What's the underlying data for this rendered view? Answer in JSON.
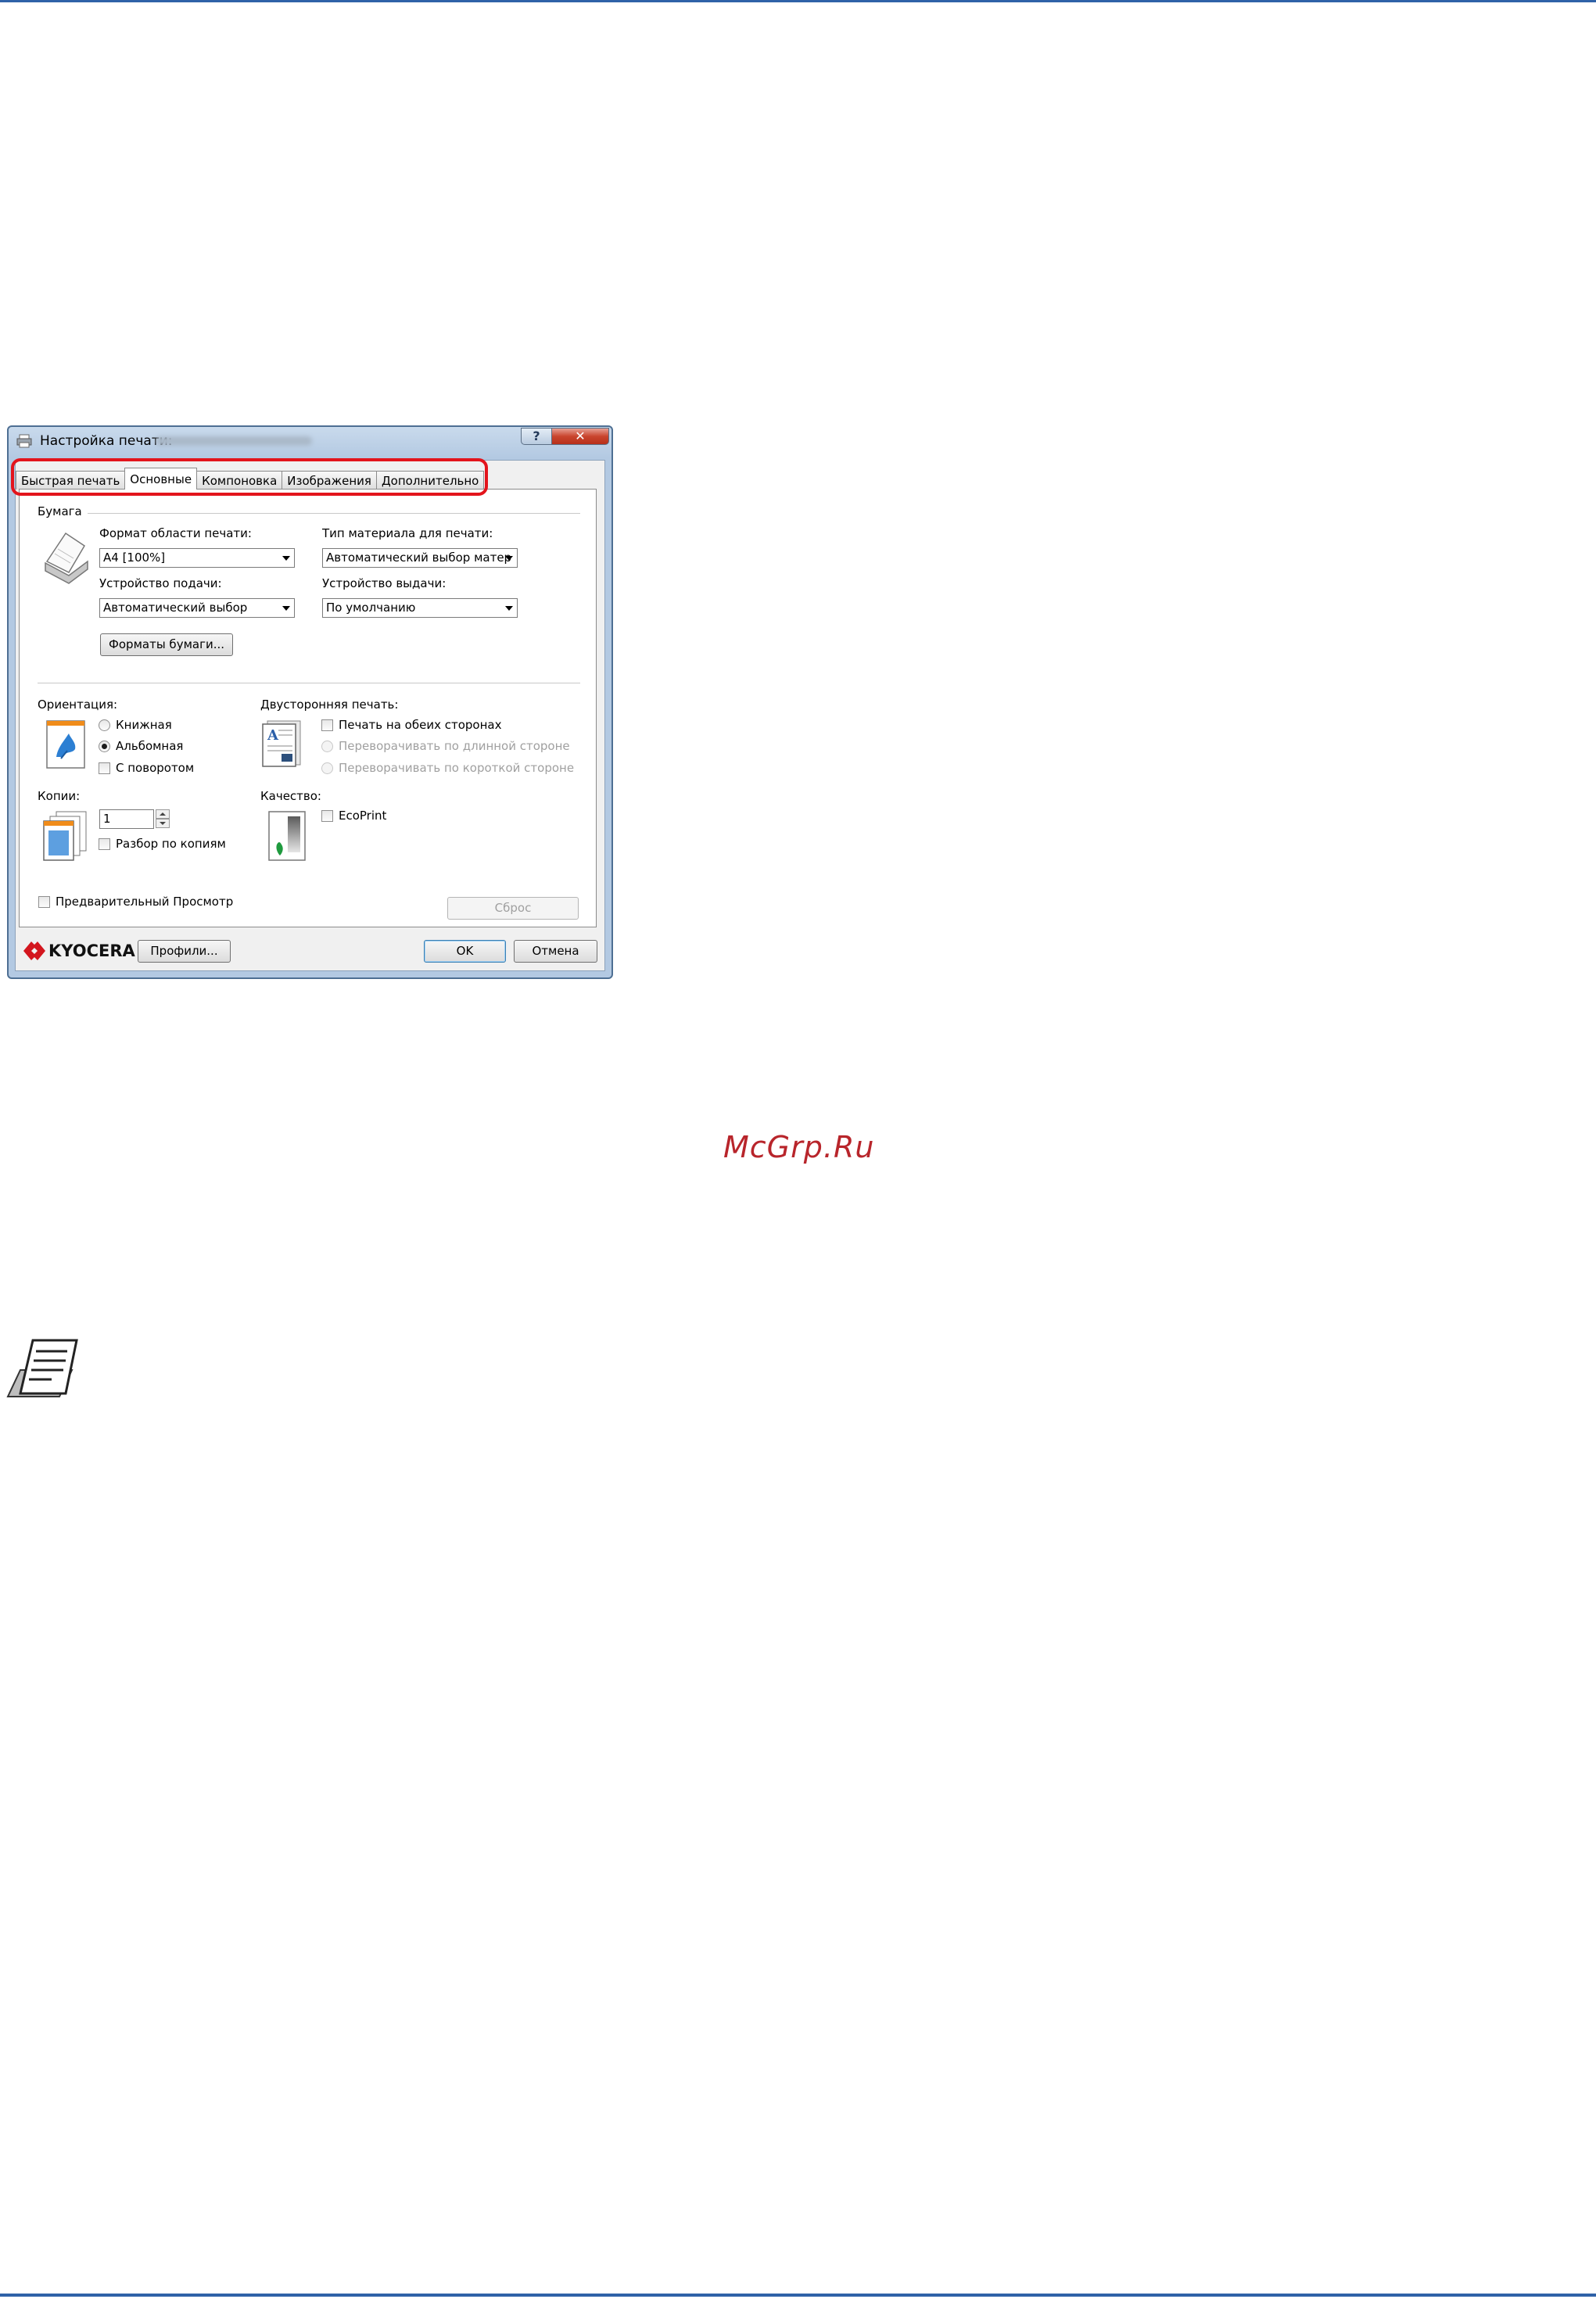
{
  "dialog": {
    "title": "Настройка печати:",
    "help_label": "?",
    "close_label": "✕",
    "tabs": [
      {
        "label": "Быстрая печать"
      },
      {
        "label": "Основные"
      },
      {
        "label": "Компоновка"
      },
      {
        "label": "Изображения"
      },
      {
        "label": "Дополнительно"
      }
    ],
    "active_tab": "Основные",
    "paper": {
      "group_label": "Бумага",
      "print_size_label": "Формат области печати:",
      "print_size_value": "A4  [100%]",
      "media_type_label": "Тип материала для печати:",
      "media_type_value": "Автоматический выбор матер",
      "source_label": "Устройство подачи:",
      "source_value": "Автоматический выбор",
      "output_label": "Устройство выдачи:",
      "output_value": "По умолчанию",
      "page_sizes_button": "Форматы бумаги..."
    },
    "orientation": {
      "label": "Ориентация:",
      "portrait": "Книжная",
      "landscape": "Альбомная",
      "rotated": "С поворотом",
      "selected": "Альбомная"
    },
    "duplex": {
      "label": "Двусторонняя печать:",
      "both_sides": "Печать на обеих сторонах",
      "flip_long": "Переворачивать по длинной стороне",
      "flip_short": "Переворачивать по короткой стороне"
    },
    "copies": {
      "label": "Копии:",
      "value": "1",
      "collate": "Разбор по копиям"
    },
    "quality": {
      "label": "Качество:",
      "ecoprint": "EcoPrint"
    },
    "preview_label": "Предварительный Просмотр",
    "reset_button": "Сброс",
    "brand": "KYOCERA",
    "profiles_button": "Профили...",
    "ok_button": "OK",
    "cancel_button": "Отмена"
  },
  "watermark": "McGrp.Ru",
  "colors": {
    "rule": "#2f62a8",
    "highlight": "#e3141c",
    "brand": "#d3161e",
    "watermark": "#b8252b"
  }
}
